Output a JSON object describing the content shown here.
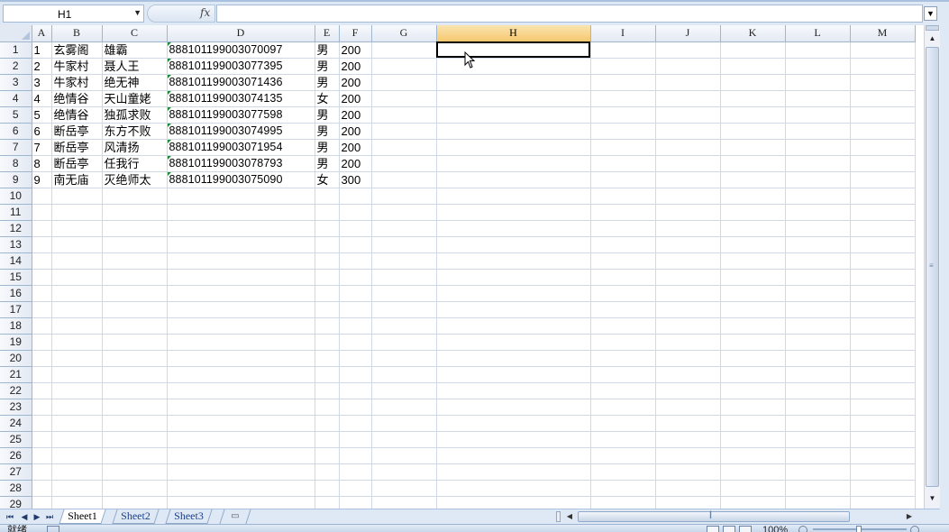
{
  "formula_bar": {
    "name_box": "H1",
    "fx_label": "fx",
    "formula_value": ""
  },
  "columns": [
    "A",
    "B",
    "C",
    "D",
    "E",
    "F",
    "G",
    "H",
    "I",
    "J",
    "K",
    "L",
    "M"
  ],
  "selected_column": "H",
  "rows": [
    {
      "num": "1",
      "cells": [
        "1",
        "玄雾阁",
        "雄霸",
        "888101199003070097",
        "男",
        "200"
      ]
    },
    {
      "num": "2",
      "cells": [
        "2",
        "牛家村",
        "聂人王",
        "888101199003077395",
        "男",
        "200"
      ]
    },
    {
      "num": "3",
      "cells": [
        "3",
        "牛家村",
        "绝无神",
        "888101199003071436",
        "男",
        "200"
      ]
    },
    {
      "num": "4",
      "cells": [
        "4",
        "绝情谷",
        "天山童姥",
        "888101199003074135",
        "女",
        "200"
      ]
    },
    {
      "num": "5",
      "cells": [
        "5",
        "绝情谷",
        "独孤求败",
        "888101199003077598",
        "男",
        "200"
      ]
    },
    {
      "num": "6",
      "cells": [
        "6",
        "断岳亭",
        "东方不败",
        "888101199003074995",
        "男",
        "200"
      ]
    },
    {
      "num": "7",
      "cells": [
        "7",
        "断岳亭",
        "风清扬",
        "888101199003071954",
        "男",
        "200"
      ]
    },
    {
      "num": "8",
      "cells": [
        "8",
        "断岳亭",
        "任我行",
        "888101199003078793",
        "男",
        "200"
      ]
    },
    {
      "num": "9",
      "cells": [
        "9",
        "南无庙",
        "灭绝师太",
        "888101199003075090",
        "女",
        "300"
      ]
    }
  ],
  "empty_row_numbers": [
    "10",
    "11",
    "12",
    "13",
    "14",
    "15",
    "16",
    "17",
    "18",
    "19",
    "20",
    "21",
    "22",
    "23",
    "24",
    "25",
    "26",
    "27",
    "28",
    "29"
  ],
  "sheet_tabs": [
    {
      "label": "Sheet1",
      "active": true
    },
    {
      "label": "Sheet2",
      "active": false
    },
    {
      "label": "Sheet3",
      "active": false
    }
  ],
  "status_bar": {
    "status_text": "就绪",
    "zoom": "100%",
    "zoom_level_percent": 100
  },
  "icons": {
    "name_box_dropdown": "chevron-down-icon",
    "formula_expand": "chevron-down-icon",
    "insert_sheet": "insert-sheet-icon",
    "cursor": "mouse-pointer-icon"
  },
  "colors": {
    "grid_line": "#d0d7e5",
    "header_bg": "#e3e9f3",
    "selected_header": "#f6c86e",
    "text_marker": "#1a8a2e",
    "chrome_bg": "#dfe8f5"
  }
}
